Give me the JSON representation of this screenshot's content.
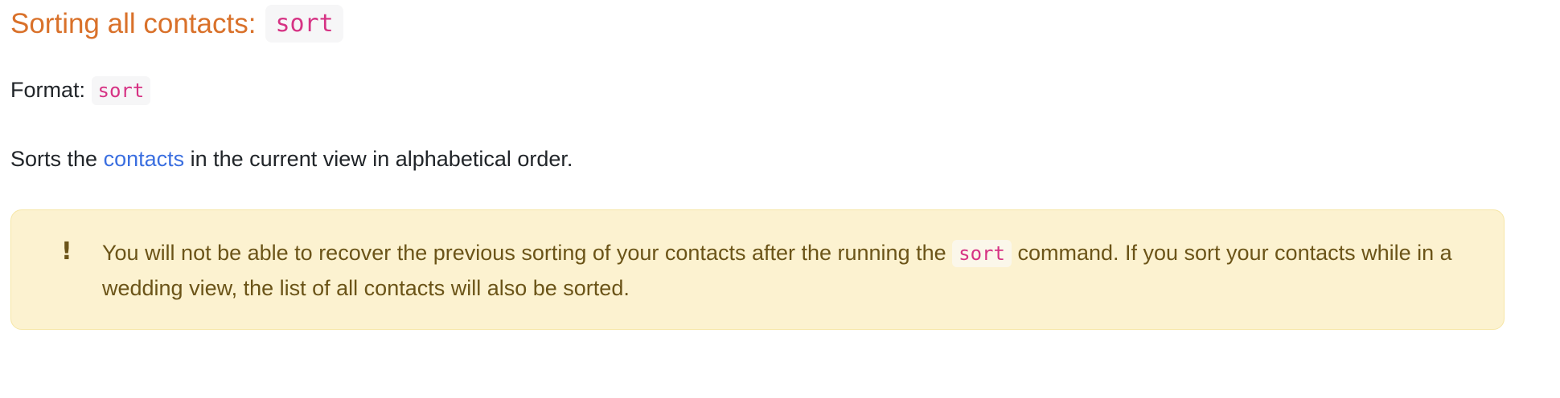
{
  "heading": {
    "text": "Sorting all contacts:",
    "code": "sort"
  },
  "format": {
    "label": "Format:",
    "code": "sort"
  },
  "description": {
    "before": "Sorts the ",
    "link": "contacts",
    "after": " in the current view in alphabetical order."
  },
  "alert": {
    "icon": "exclamation-icon",
    "before": "You will not be able to recover the previous sorting of your contacts after the running the ",
    "code": "sort",
    "after": " command. If you sort your contacts while in a wedding view, the list of all contacts will also be sorted."
  },
  "colors": {
    "heading": "#d9712a",
    "code": "#d63384",
    "link": "#3b6fe0",
    "alert_bg": "#fcf2d0",
    "alert_text": "#6b5418"
  }
}
